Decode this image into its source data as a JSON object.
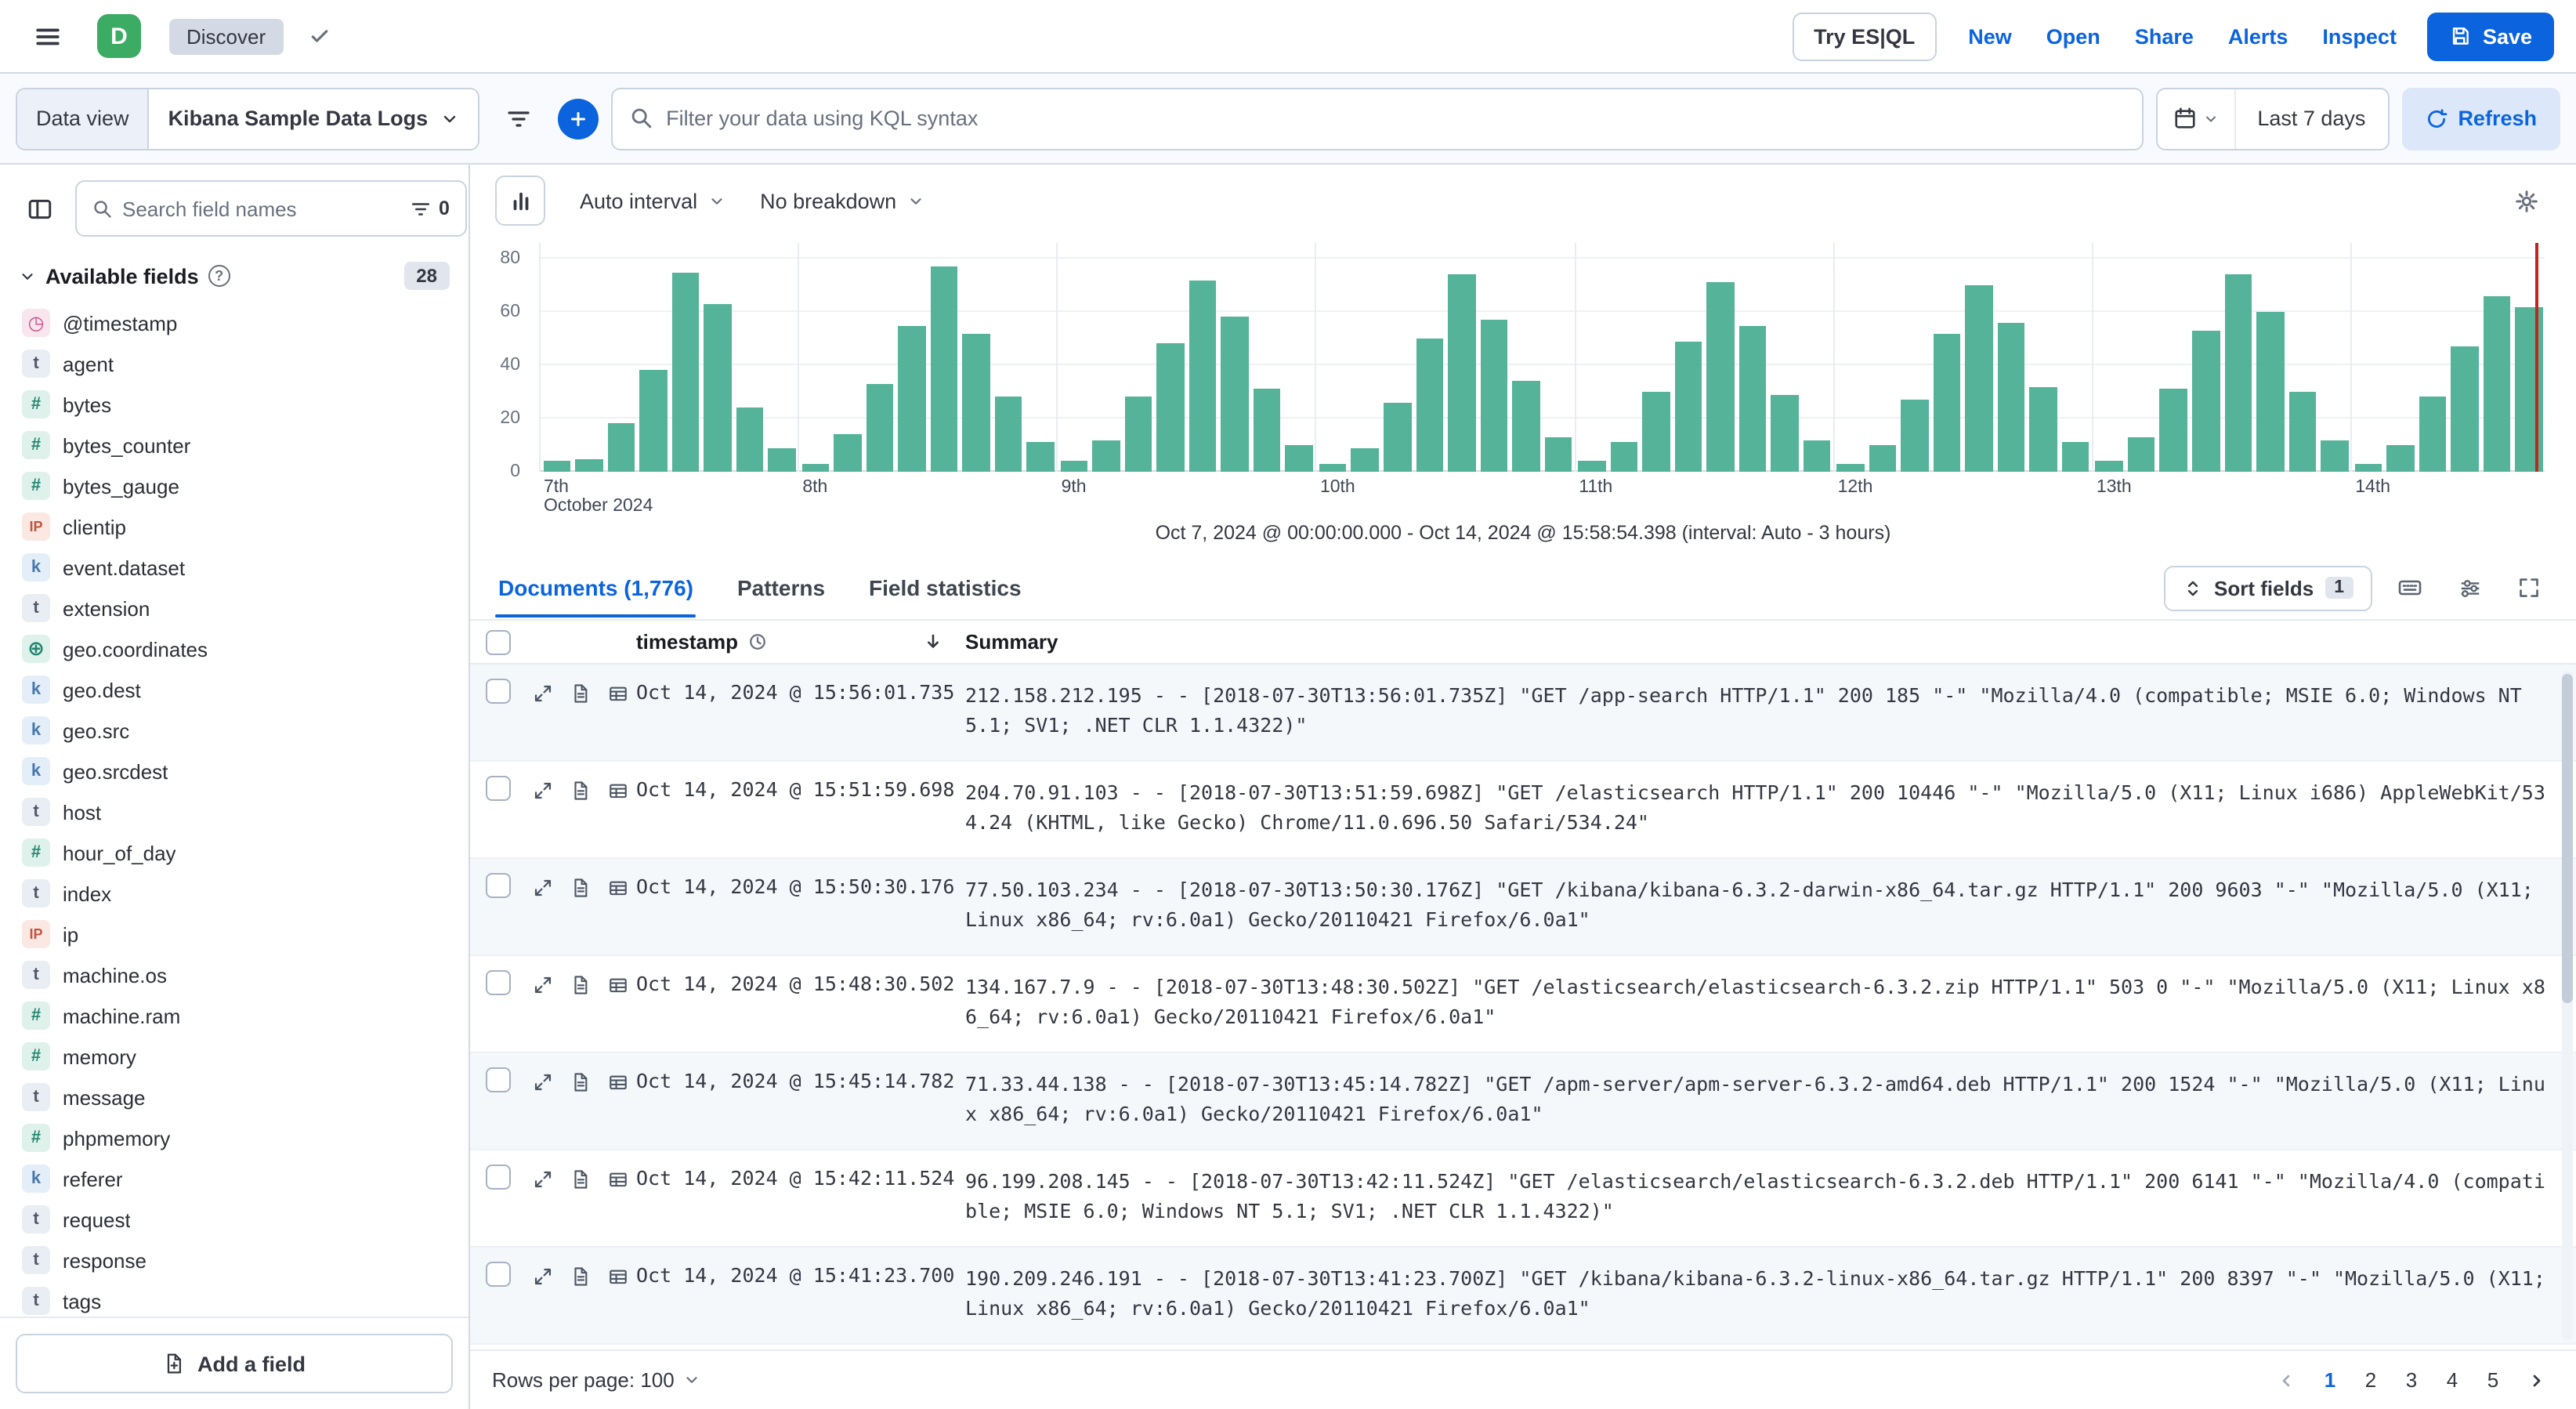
{
  "header": {
    "logo_text": "D",
    "breadcrumb": "Discover",
    "try_esql_label": "Try ES|QL",
    "nav_links": [
      "New",
      "Open",
      "Share",
      "Alerts",
      "Inspect"
    ],
    "save_label": "Save"
  },
  "query_bar": {
    "data_view_label": "Data view",
    "data_view_value": "Kibana Sample Data Logs",
    "kql_placeholder": "Filter your data using KQL syntax",
    "time_range": "Last 7 days",
    "refresh_label": "Refresh"
  },
  "sidebar": {
    "search_placeholder": "Search field names",
    "type_filter_count": "0",
    "available_fields_label": "Available fields",
    "info_glyph": "?",
    "available_fields_count": "28",
    "add_field_label": "Add a field",
    "fields": [
      {
        "name": "@timestamp",
        "type": "date",
        "badge": "◷"
      },
      {
        "name": "agent",
        "type": "text",
        "badge": "t"
      },
      {
        "name": "bytes",
        "type": "number",
        "badge": "#"
      },
      {
        "name": "bytes_counter",
        "type": "number",
        "badge": "#"
      },
      {
        "name": "bytes_gauge",
        "type": "number",
        "badge": "#"
      },
      {
        "name": "clientip",
        "type": "ip",
        "badge": "IP"
      },
      {
        "name": "event.dataset",
        "type": "keyword",
        "badge": "k"
      },
      {
        "name": "extension",
        "type": "text",
        "badge": "t"
      },
      {
        "name": "geo.coordinates",
        "type": "geo_point",
        "badge": "⊕"
      },
      {
        "name": "geo.dest",
        "type": "keyword",
        "badge": "k"
      },
      {
        "name": "geo.src",
        "type": "keyword",
        "badge": "k"
      },
      {
        "name": "geo.srcdest",
        "type": "keyword",
        "badge": "k"
      },
      {
        "name": "host",
        "type": "text",
        "badge": "t"
      },
      {
        "name": "hour_of_day",
        "type": "number",
        "badge": "#"
      },
      {
        "name": "index",
        "type": "text",
        "badge": "t"
      },
      {
        "name": "ip",
        "type": "ip",
        "badge": "IP"
      },
      {
        "name": "machine.os",
        "type": "text",
        "badge": "t"
      },
      {
        "name": "machine.ram",
        "type": "number",
        "badge": "#"
      },
      {
        "name": "memory",
        "type": "number",
        "badge": "#"
      },
      {
        "name": "message",
        "type": "text",
        "badge": "t"
      },
      {
        "name": "phpmemory",
        "type": "number",
        "badge": "#"
      },
      {
        "name": "referer",
        "type": "keyword",
        "badge": "k"
      },
      {
        "name": "request",
        "type": "text",
        "badge": "t"
      },
      {
        "name": "response",
        "type": "text",
        "badge": "t"
      },
      {
        "name": "tags",
        "type": "text",
        "badge": "t"
      }
    ]
  },
  "chart": {
    "interval_label": "Auto interval",
    "breakdown_label": "No breakdown",
    "caption": "Oct 7, 2024 @ 00:00:00.000 - Oct 14, 2024 @ 15:58:54.398 (interval: Auto - 3 hours)"
  },
  "chart_data": {
    "type": "bar",
    "ylim": [
      0,
      80
    ],
    "yticks": [
      0,
      20,
      40,
      60,
      80
    ],
    "interval": "3 hours",
    "bar_color": "#54B399",
    "now_marker_color": "#BD271E",
    "days": [
      {
        "tick": "7th",
        "sub": "October 2024",
        "values": [
          4,
          5,
          18,
          38,
          75,
          63,
          24,
          9
        ]
      },
      {
        "tick": "8th",
        "values": [
          3,
          14,
          33,
          55,
          77,
          52,
          28,
          11
        ]
      },
      {
        "tick": "9th",
        "values": [
          4,
          12,
          28,
          48,
          72,
          58,
          31,
          10
        ]
      },
      {
        "tick": "10th",
        "values": [
          3,
          9,
          26,
          50,
          74,
          57,
          34,
          13
        ]
      },
      {
        "tick": "11th",
        "values": [
          4,
          11,
          30,
          49,
          71,
          55,
          29,
          12
        ]
      },
      {
        "tick": "12th",
        "values": [
          3,
          10,
          27,
          52,
          70,
          56,
          32,
          11
        ]
      },
      {
        "tick": "13th",
        "values": [
          4,
          13,
          31,
          53,
          74,
          60,
          30,
          12
        ]
      },
      {
        "tick": "14th",
        "values": [
          3,
          10,
          28,
          47,
          66,
          62
        ]
      }
    ]
  },
  "documents": {
    "tabs": [
      {
        "label": "Documents (1,776)",
        "active": "true"
      },
      {
        "label": "Patterns",
        "active": "false"
      },
      {
        "label": "Field statistics",
        "active": "false"
      }
    ],
    "sort_fields_label": "Sort fields",
    "sort_fields_count": "1",
    "columns": {
      "timestamp": "timestamp",
      "summary": "Summary"
    },
    "rows": [
      {
        "timestamp": "Oct 14, 2024 @ 15:56:01.735",
        "summary": "212.158.212.195 - - [2018-07-30T13:56:01.735Z] \"GET /app-search HTTP/1.1\" 200 185 \"-\" \"Mozilla/4.0 (compatible; MSIE 6.0; Windows NT 5.1; SV1; .NET CLR 1.1.4322)\""
      },
      {
        "timestamp": "Oct 14, 2024 @ 15:51:59.698",
        "summary": "204.70.91.103 - - [2018-07-30T13:51:59.698Z] \"GET /elasticsearch HTTP/1.1\" 200 10446 \"-\" \"Mozilla/5.0 (X11; Linux i686) AppleWebKit/534.24 (KHTML, like Gecko) Chrome/11.0.696.50 Safari/534.24\""
      },
      {
        "timestamp": "Oct 14, 2024 @ 15:50:30.176",
        "summary": "77.50.103.234 - - [2018-07-30T13:50:30.176Z] \"GET /kibana/kibana-6.3.2-darwin-x86_64.tar.gz HTTP/1.1\" 200 9603 \"-\" \"Mozilla/5.0 (X11; Linux x86_64; rv:6.0a1) Gecko/20110421 Firefox/6.0a1\""
      },
      {
        "timestamp": "Oct 14, 2024 @ 15:48:30.502",
        "summary": "134.167.7.9 - - [2018-07-30T13:48:30.502Z] \"GET /elasticsearch/elasticsearch-6.3.2.zip HTTP/1.1\" 503 0 \"-\" \"Mozilla/5.0 (X11; Linux x86_64; rv:6.0a1) Gecko/20110421 Firefox/6.0a1\""
      },
      {
        "timestamp": "Oct 14, 2024 @ 15:45:14.782",
        "summary": "71.33.44.138 - - [2018-07-30T13:45:14.782Z] \"GET /apm-server/apm-server-6.3.2-amd64.deb HTTP/1.1\" 200 1524 \"-\" \"Mozilla/5.0 (X11; Linux x86_64; rv:6.0a1) Gecko/20110421 Firefox/6.0a1\""
      },
      {
        "timestamp": "Oct 14, 2024 @ 15:42:11.524",
        "summary": "96.199.208.145 - - [2018-07-30T13:42:11.524Z] \"GET /elasticsearch/elasticsearch-6.3.2.deb HTTP/1.1\" 200 6141 \"-\" \"Mozilla/4.0 (compatible; MSIE 6.0; Windows NT 5.1; SV1; .NET CLR 1.1.4322)\""
      },
      {
        "timestamp": "Oct 14, 2024 @ 15:41:23.700",
        "summary": "190.209.246.191 - - [2018-07-30T13:41:23.700Z] \"GET /kibana/kibana-6.3.2-linux-x86_64.tar.gz HTTP/1.1\" 200 8397 \"-\" \"Mozilla/5.0 (X11; Linux x86_64; rv:6.0a1) Gecko/20110421 Firefox/6.0a1\""
      }
    ]
  },
  "footer": {
    "rows_per_page": "Rows per page: 100",
    "pages": [
      {
        "label": "1",
        "active": "true"
      },
      {
        "label": "2",
        "active": "false"
      },
      {
        "label": "3",
        "active": "false"
      },
      {
        "label": "4",
        "active": "false"
      },
      {
        "label": "5",
        "active": "false"
      }
    ]
  }
}
